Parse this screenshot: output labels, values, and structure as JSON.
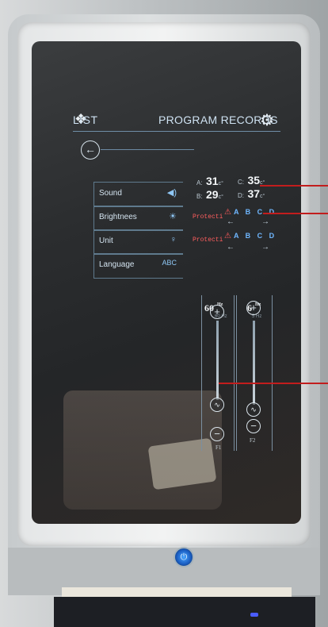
{
  "header": {
    "list_label": "LIST",
    "program_records_label": "PROGRAM RECORDS"
  },
  "settings_menu": [
    {
      "label": "Sound",
      "icon": "speaker-icon",
      "icon_glyph": "◀)"
    },
    {
      "label": "Brightnees",
      "icon": "sun-icon",
      "icon_glyph": "☀"
    },
    {
      "label": "Unit",
      "icon": "person-icon",
      "icon_glyph": "♀"
    },
    {
      "label": "Language",
      "icon": "abc-icon",
      "icon_glyph": "ABC"
    }
  ],
  "temperatures": {
    "a": {
      "label": "A:",
      "value": "31",
      "unit": "c°"
    },
    "b": {
      "label": "B:",
      "value": "29",
      "unit": "c°"
    },
    "c": {
      "label": "C:",
      "value": "35",
      "unit": "c°"
    },
    "d": {
      "label": "D:",
      "value": "37",
      "unit": "c°"
    }
  },
  "protection": [
    {
      "label": "Protecti",
      "channels": "A B C D"
    },
    {
      "label": "Protecti",
      "channels": "A B C D"
    }
  ],
  "frequency": {
    "f1": {
      "value": "60",
      "unit": "Hz",
      "sub": "60 Hz",
      "label": "F1"
    },
    "f2": {
      "value": "6",
      "unit": "Hz",
      "sub": "5 Hz",
      "label": "F2"
    }
  },
  "colors": {
    "accent": "#6fb7ff",
    "warning": "#ff5e5e",
    "power_led": "#2f85ff"
  }
}
